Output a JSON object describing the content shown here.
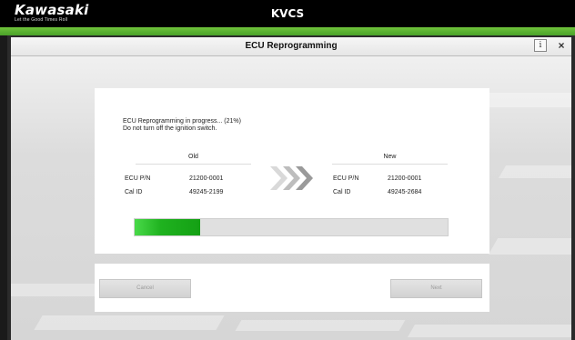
{
  "app": {
    "brand_name": "Kawasaki",
    "brand_tagline": "Let the Good Times Roll",
    "title": "KVCS"
  },
  "header": {
    "screen_title": "ECU Reprogramming",
    "info_label": "i",
    "close_label": "×"
  },
  "progress": {
    "status_line1": "ECU Reprogramming in progress... (21%)",
    "status_line2": "Do not turn off the ignition switch.",
    "percent": 21
  },
  "old": {
    "title": "Old",
    "ecu_pn_label": "ECU P/N",
    "ecu_pn_value": "21200-0001",
    "cal_id_label": "Cal ID",
    "cal_id_value": "49245-2199"
  },
  "new": {
    "title": "New",
    "ecu_pn_label": "ECU P/N",
    "ecu_pn_value": "21200-0001",
    "cal_id_label": "Cal ID",
    "cal_id_value": "49245-2684"
  },
  "buttons": {
    "cancel_label": "Cancel",
    "next_label": "Next"
  },
  "colors": {
    "accent_green": "#4aa12a",
    "progress_green": "#14a014"
  }
}
